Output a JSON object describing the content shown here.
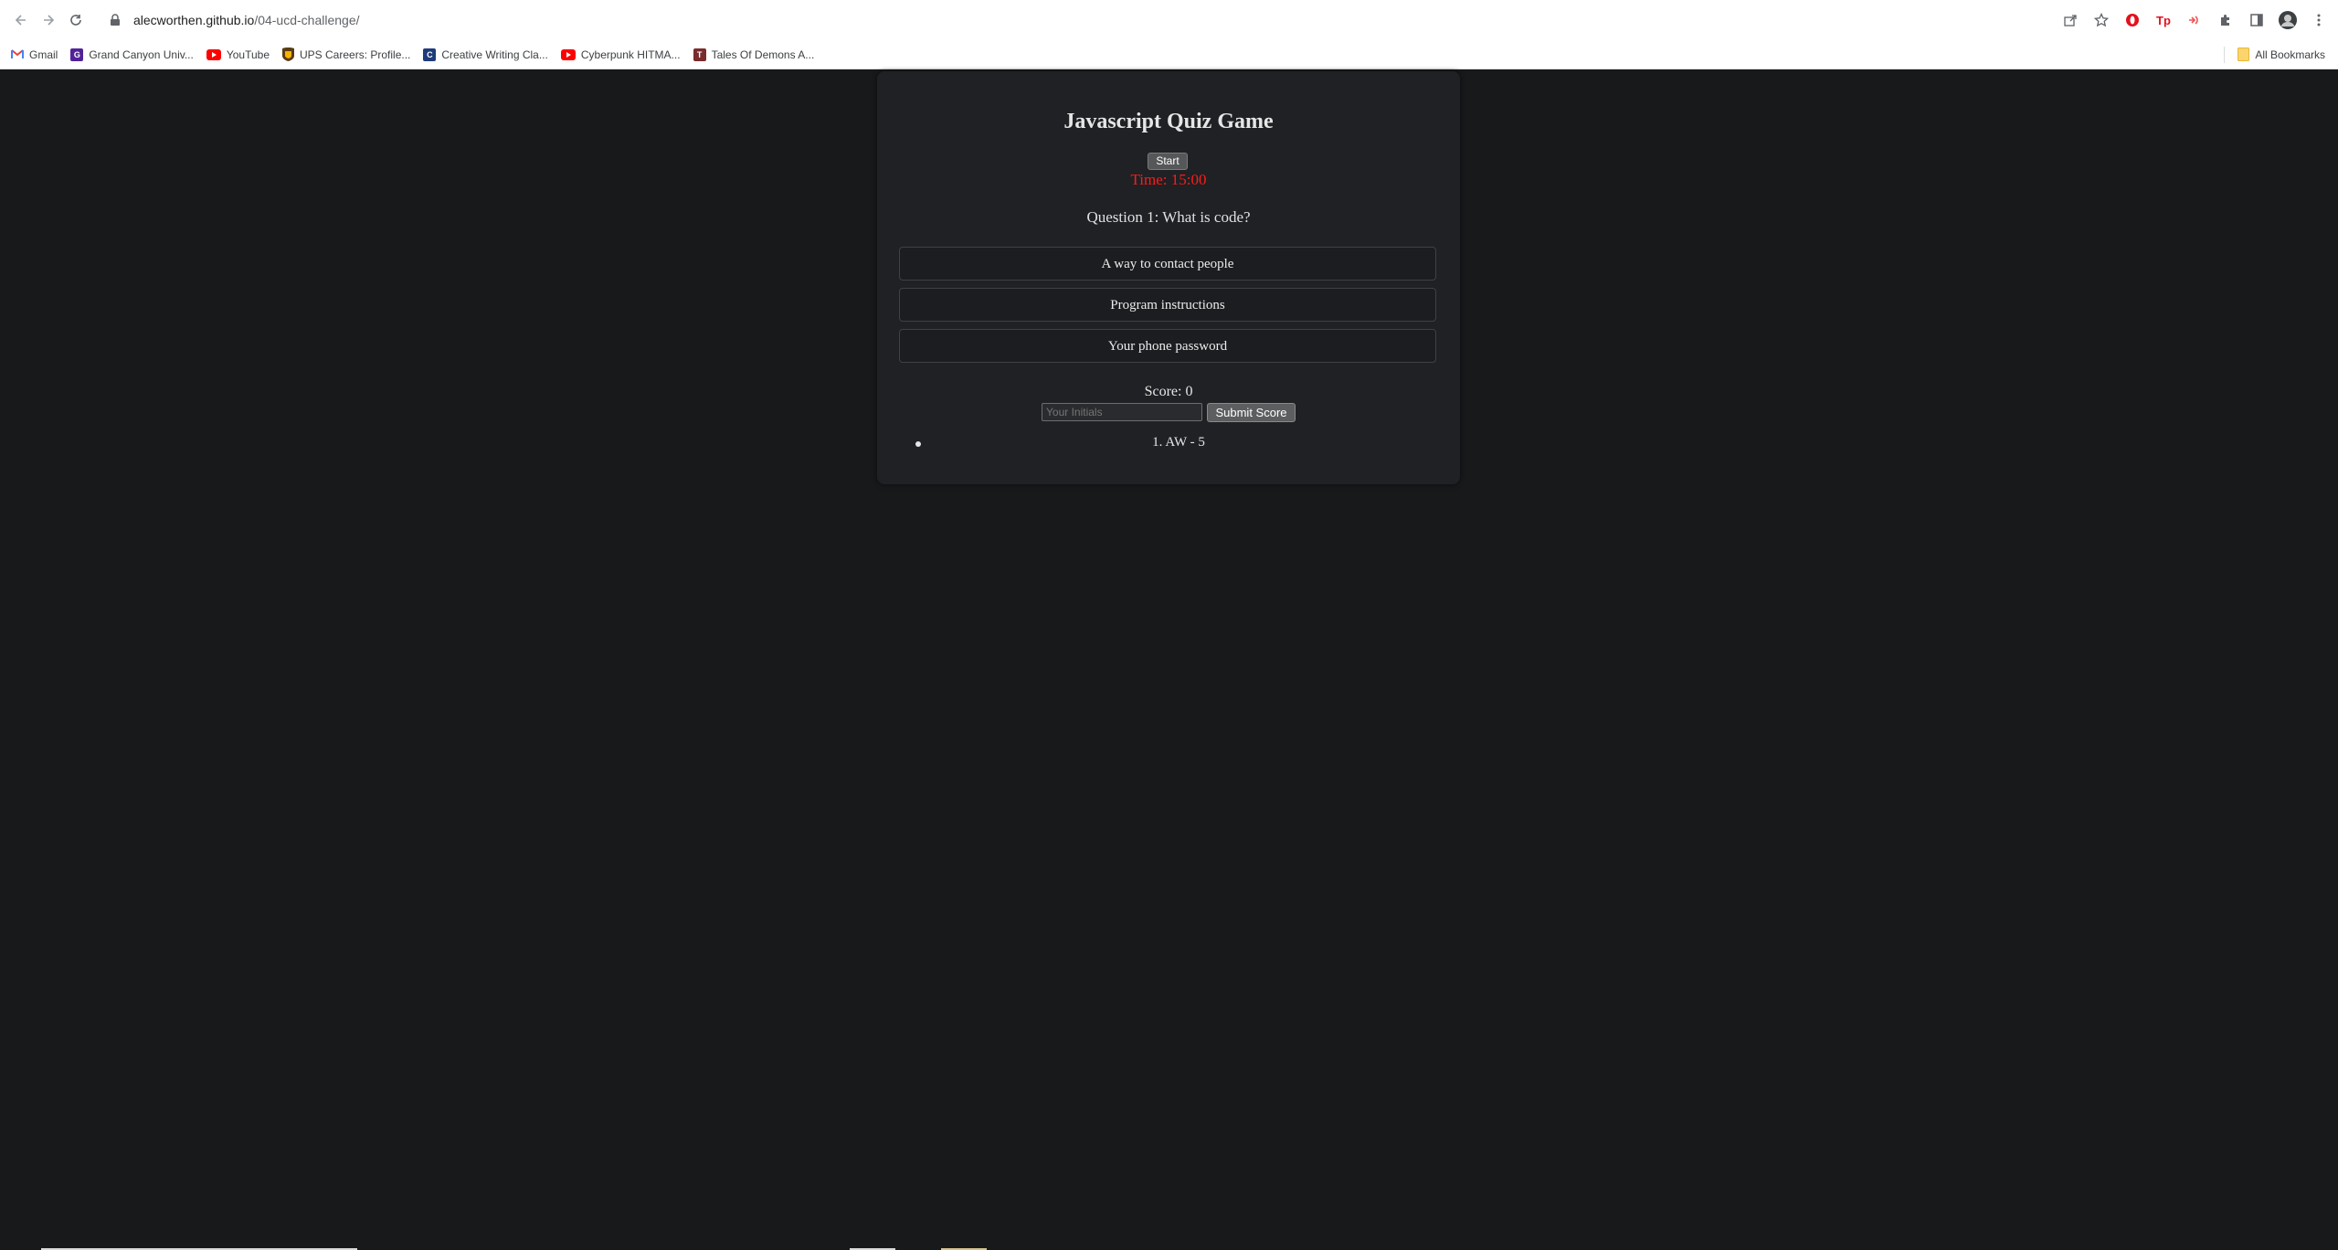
{
  "browser": {
    "url_domain": "alecworthen.github.io",
    "url_path": "/04-ucd-challenge/",
    "bookmarks": [
      {
        "label": "Gmail",
        "icon": "gmail-icon",
        "color": "#ea4335"
      },
      {
        "label": "Grand Canyon Univ...",
        "icon": "gcu-icon",
        "color": "#522398"
      },
      {
        "label": "YouTube",
        "icon": "youtube-icon",
        "color": "#ff0000"
      },
      {
        "label": "UPS Careers: Profile...",
        "icon": "ups-icon",
        "color": "#6b4a1b"
      },
      {
        "label": "Creative Writing Cla...",
        "icon": "creative-writing-icon",
        "color": "#1f3b7a"
      },
      {
        "label": "Cyberpunk HITMA...",
        "icon": "youtube-icon",
        "color": "#ff0000"
      },
      {
        "label": "Tales Of Demons A...",
        "icon": "tales-icon",
        "color": "#7a2b2b"
      }
    ],
    "all_bookmarks_label": "All Bookmarks"
  },
  "quiz": {
    "title": "Javascript Quiz Game",
    "start_label": "Start",
    "timer": "Time: 15:00",
    "question": "Question 1: What is code?",
    "answers": [
      "A way to contact people",
      "Program instructions",
      "Your phone password"
    ],
    "score": "Score: 0",
    "initials_placeholder": "Your Initials",
    "submit_label": "Submit Score",
    "highscores": [
      "1. AW - 5"
    ]
  },
  "colors": {
    "page_background": "#18191b",
    "card_background": "#1f2124",
    "timer_color": "#ff1a1a"
  }
}
